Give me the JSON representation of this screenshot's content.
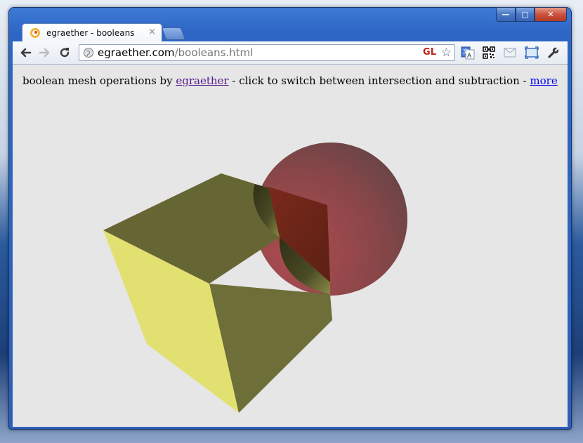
{
  "window": {
    "controls": {
      "minimize": "—",
      "maximize": "▢",
      "close": "✕"
    }
  },
  "tab": {
    "title": "egraether - booleans",
    "close": "×"
  },
  "toolbar": {
    "back_icon": "←",
    "forward_icon": "→",
    "reload_icon": "↻",
    "url_host": "egraether.com",
    "url_path": "/booleans.html",
    "gl_badge": "GL",
    "bookmark_star": "☆",
    "wrench_icon": "🔧"
  },
  "page": {
    "text_before": "boolean mesh operations by ",
    "author_link": "egraether",
    "text_middle": " - click to switch between intersection and subtraction - ",
    "more_link": "more"
  },
  "scene": {
    "cube_top_color": "#666634",
    "cube_left_color": "#e2e070",
    "cube_right_color": "#6e6e38",
    "sphere_light": "#a34a4e",
    "sphere_dark": "#5f4446",
    "cut_color": "#6b2218"
  }
}
